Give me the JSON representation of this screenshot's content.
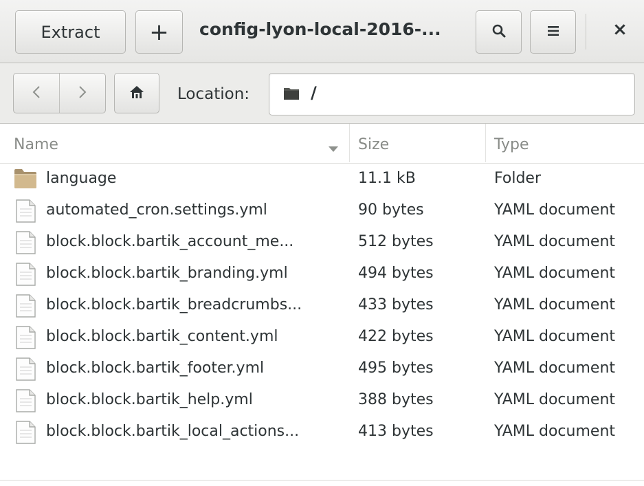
{
  "header": {
    "extract_label": "Extract",
    "add_label": "+",
    "title": "config-lyon-local-2016-...",
    "search_icon": "search-icon",
    "menu_icon": "hamburger-menu-icon",
    "close_label": "×"
  },
  "location": {
    "back_icon": "chevron-left-icon",
    "forward_icon": "chevron-right-icon",
    "home_icon": "home-icon",
    "label": "Location:",
    "folder_icon": "folder-icon",
    "path": "/"
  },
  "columns": {
    "name": "Name",
    "size": "Size",
    "type": "Type"
  },
  "files": [
    {
      "name": "language",
      "size": "11.1 kB",
      "type": "Folder",
      "icon": "folder-icon"
    },
    {
      "name": "automated_cron.settings.yml",
      "size": "90 bytes",
      "type": "YAML document",
      "icon": "document-icon"
    },
    {
      "name": "block.block.bartik_account_me...",
      "size": "512 bytes",
      "type": "YAML document",
      "icon": "document-icon"
    },
    {
      "name": "block.block.bartik_branding.yml",
      "size": "494 bytes",
      "type": "YAML document",
      "icon": "document-icon"
    },
    {
      "name": "block.block.bartik_breadcrumbs...",
      "size": "433 bytes",
      "type": "YAML document",
      "icon": "document-icon"
    },
    {
      "name": "block.block.bartik_content.yml",
      "size": "422 bytes",
      "type": "YAML document",
      "icon": "document-icon"
    },
    {
      "name": "block.block.bartik_footer.yml",
      "size": "495 bytes",
      "type": "YAML document",
      "icon": "document-icon"
    },
    {
      "name": "block.block.bartik_help.yml",
      "size": "388 bytes",
      "type": "YAML document",
      "icon": "document-icon"
    },
    {
      "name": "block.block.bartik_local_actions...",
      "size": "413 bytes",
      "type": "YAML document",
      "icon": "document-icon"
    }
  ]
}
